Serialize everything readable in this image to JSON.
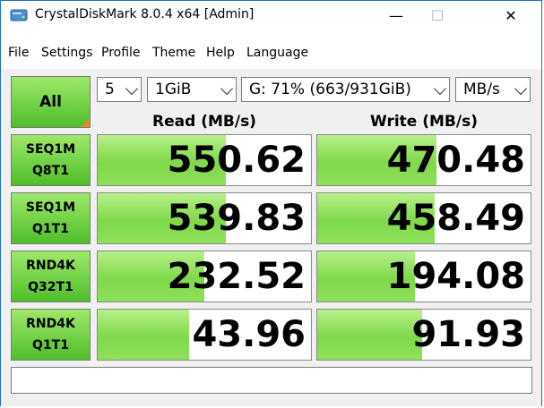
{
  "window": {
    "title": "CrystalDiskMark 8.0.4 x64 [Admin]",
    "min_glyph": "—",
    "max_glyph": "☐",
    "close_glyph": "✕"
  },
  "menu": [
    "File",
    "Settings",
    "Profile",
    "Theme",
    "Help",
    "Language"
  ],
  "controls": {
    "all_label": "All",
    "count": "5",
    "size": "1GiB",
    "drive": "G: 71% (663/931GiB)",
    "unit": "MB/s"
  },
  "headers": {
    "read": "Read (MB/s)",
    "write": "Write (MB/s)"
  },
  "rows": [
    {
      "line1": "SEQ1M",
      "line2": "Q8T1",
      "read": "550.62",
      "write": "470.48",
      "read_fill": 0.6,
      "write_fill": 0.56
    },
    {
      "line1": "SEQ1M",
      "line2": "Q1T1",
      "read": "539.83",
      "write": "458.49",
      "read_fill": 0.6,
      "write_fill": 0.55
    },
    {
      "line1": "RND4K",
      "line2": "Q32T1",
      "read": "232.52",
      "write": "194.08",
      "read_fill": 0.5,
      "write_fill": 0.46
    },
    {
      "line1": "RND4K",
      "line2": "Q1T1",
      "read": "43.96",
      "write": "91.93",
      "read_fill": 0.43,
      "write_fill": 0.49
    }
  ],
  "comment": ""
}
